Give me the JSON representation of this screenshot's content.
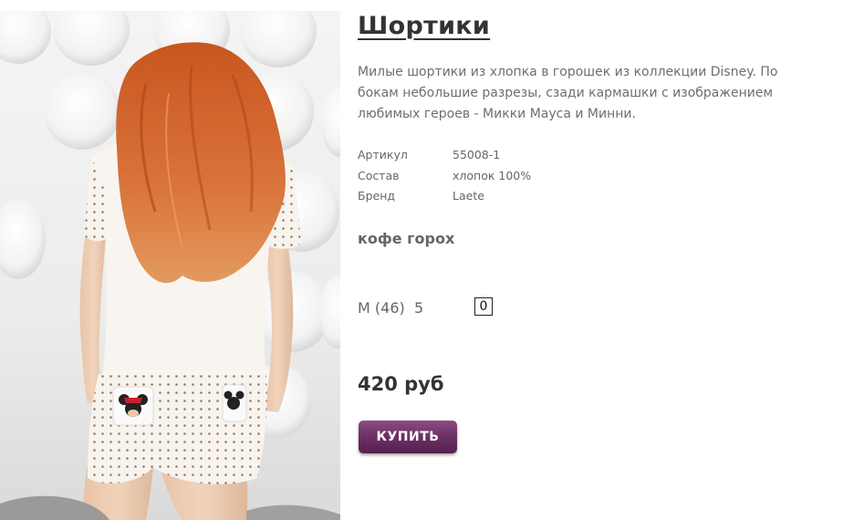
{
  "product": {
    "title": "Шортики",
    "description": "Милые шортики из хлопка в горошек из коллекции Disney. По бокам небольшие разрезы, сзади кармашки с изображением любимых героев - Микки Мауса и Минни.",
    "photo_alt": "product-photo"
  },
  "specs": [
    {
      "label": "Артикул",
      "value": "55008-1"
    },
    {
      "label": "Состав",
      "value": "хлопок 100%"
    },
    {
      "label": "Бренд",
      "value": "Laete"
    }
  ],
  "color": "кофе горох",
  "size": {
    "label": "M (46)",
    "stock": "5",
    "quantity": "0"
  },
  "price": "420 руб",
  "buy_button": {
    "label": "КУПИТЬ",
    "color": "#6c2f65"
  }
}
